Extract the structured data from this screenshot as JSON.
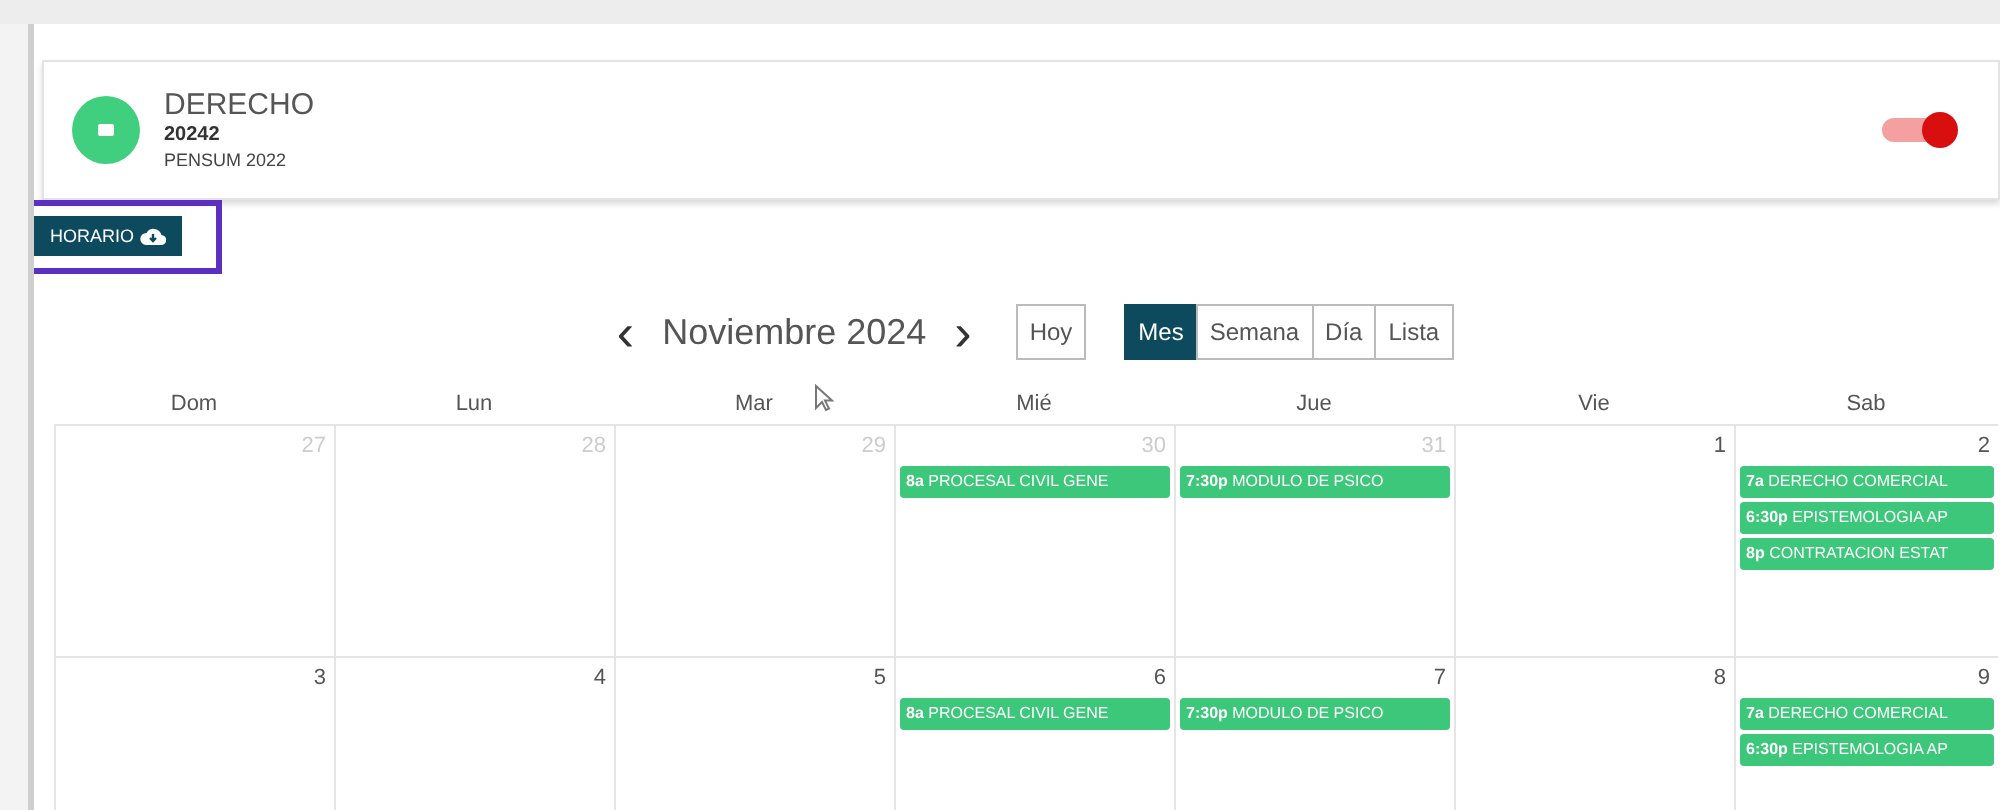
{
  "program": {
    "title": "DERECHO",
    "code": "20242",
    "pensum": "PENSUM 2022",
    "toggle_on": true
  },
  "schedule_button": {
    "label": "HORARIO",
    "highlighted": true
  },
  "calendar": {
    "title": "Noviembre 2024",
    "prev": "‹",
    "next": "›",
    "today": "Hoy",
    "views": [
      {
        "label": "Mes",
        "selected": true
      },
      {
        "label": "Semana",
        "selected": false
      },
      {
        "label": "Día",
        "selected": false
      },
      {
        "label": "Lista",
        "selected": false
      }
    ],
    "weekdays": [
      "Dom",
      "Lun",
      "Mar",
      "Mié",
      "Jue",
      "Vie",
      "Sab"
    ],
    "weeks": [
      {
        "days": [
          {
            "day": "27",
            "other_month": true
          },
          {
            "day": "28",
            "other_month": true
          },
          {
            "day": "29",
            "other_month": true
          },
          {
            "day": "30",
            "other_month": true,
            "events": [
              "**8a** PROCESAL CIVIL GENE"
            ]
          },
          {
            "day": "31",
            "other_month": true,
            "events": [
              "**7:30p** MODULO DE PSICO"
            ]
          },
          {
            "day": "1",
            "other_month": false
          },
          {
            "day": "2",
            "other_month": false,
            "events": [
              "**7a** DERECHO COMERCIAL",
              "**6:30p** EPISTEMOLOGIA AP",
              "**8p** CONTRATACION ESTAT"
            ]
          }
        ]
      },
      {
        "days": [
          {
            "day": "3",
            "other_month": false
          },
          {
            "day": "4",
            "other_month": false
          },
          {
            "day": "5",
            "other_month": false
          },
          {
            "day": "6",
            "other_month": false,
            "events": [
              "**8a** PROCESAL CIVIL GENE"
            ]
          },
          {
            "day": "7",
            "other_month": false,
            "events": [
              "**7:30p** MODULO DE PSICO"
            ]
          },
          {
            "day": "8",
            "other_month": false
          },
          {
            "day": "9",
            "other_month": false,
            "events": [
              "**7a** DERECHO COMERCIAL",
              "**6:30p** EPISTEMOLOGIA AP"
            ]
          }
        ]
      }
    ]
  }
}
